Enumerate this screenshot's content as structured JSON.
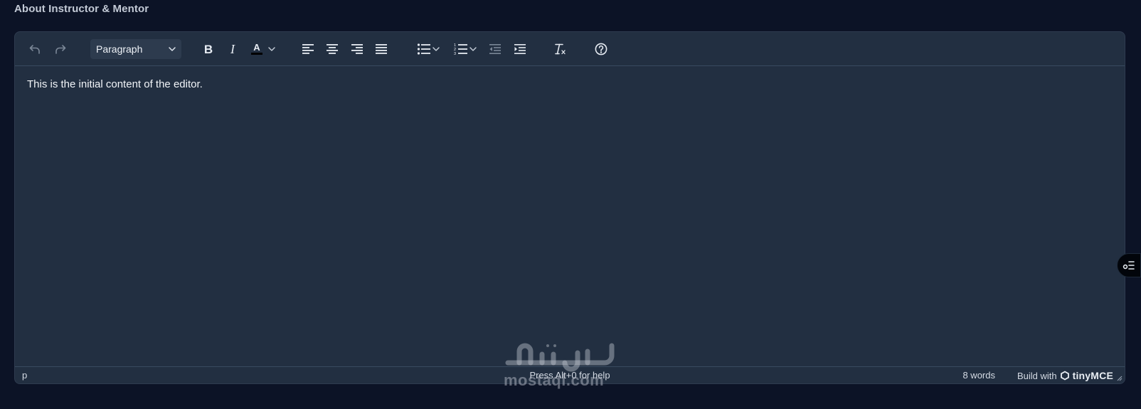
{
  "field": {
    "label": "About Instructor & Mentor"
  },
  "toolbar": {
    "undo_icon": "undo-icon",
    "redo_icon": "redo-icon",
    "block_format": {
      "selected": "Paragraph"
    },
    "buttons": [
      "bold-icon",
      "italic-icon",
      "text-color-icon",
      "align-left-icon",
      "align-center-icon",
      "align-right-icon",
      "align-justify-icon",
      "bullet-list-icon",
      "numbered-list-icon",
      "outdent-icon",
      "indent-icon",
      "clear-formatting-icon",
      "help-icon"
    ],
    "text_color_value": "#000000"
  },
  "content": {
    "text": "This is the initial content of the editor."
  },
  "statusbar": {
    "path": "p",
    "help_hint": "Press Alt+0 for help",
    "word_count": "8 words",
    "brand_prefix": "Build with",
    "brand_name": "tinyMCE"
  },
  "watermark": {
    "latin": "mostaql.com"
  },
  "colors": {
    "page_bg": "#0c1326",
    "editor_bg": "#222f41",
    "toolbar_icon": "#e6ebf2",
    "disabled_icon": "#7b8797",
    "select_bg": "#2d3b4e"
  }
}
